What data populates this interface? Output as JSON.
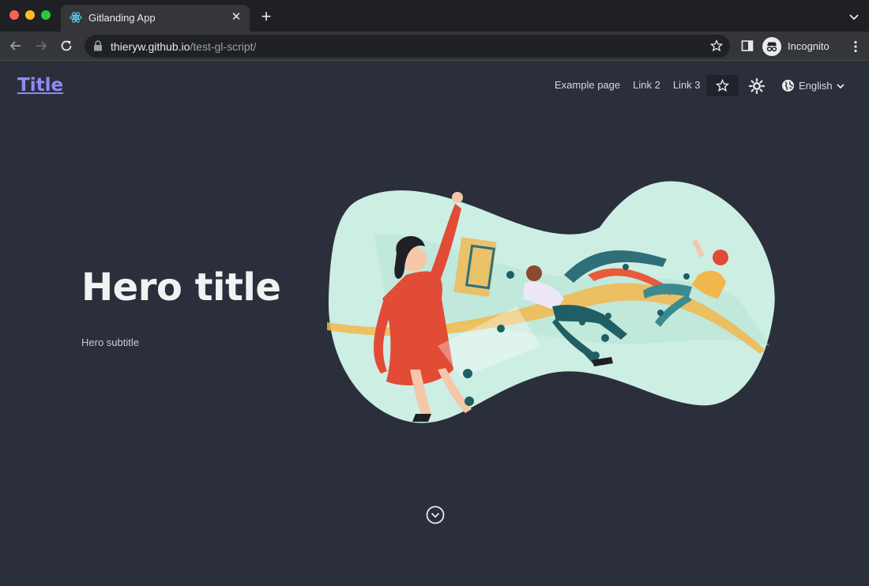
{
  "browser": {
    "tab_title": "Gitlanding App",
    "url_host": "thieryw.github.io",
    "url_path": "/test-gl-script/",
    "profile_label": "Incognito"
  },
  "header": {
    "title": "Title",
    "links": [
      "Example page",
      "Link 2",
      "Link 3"
    ],
    "language": "English"
  },
  "hero": {
    "title": "Hero title",
    "subtitle": "Hero subtitle"
  },
  "icons": {
    "tab_favicon": "react-icon",
    "github_star": "star-icon",
    "theme_toggle": "sun-icon",
    "language": "globe-icon",
    "scroll": "chevron-down-circle-icon"
  },
  "colors": {
    "page_bg": "#2b2f3b",
    "title_link": "#8d8cf3",
    "hero_text": "#f2f2f2",
    "blob": "#cdeee3"
  }
}
